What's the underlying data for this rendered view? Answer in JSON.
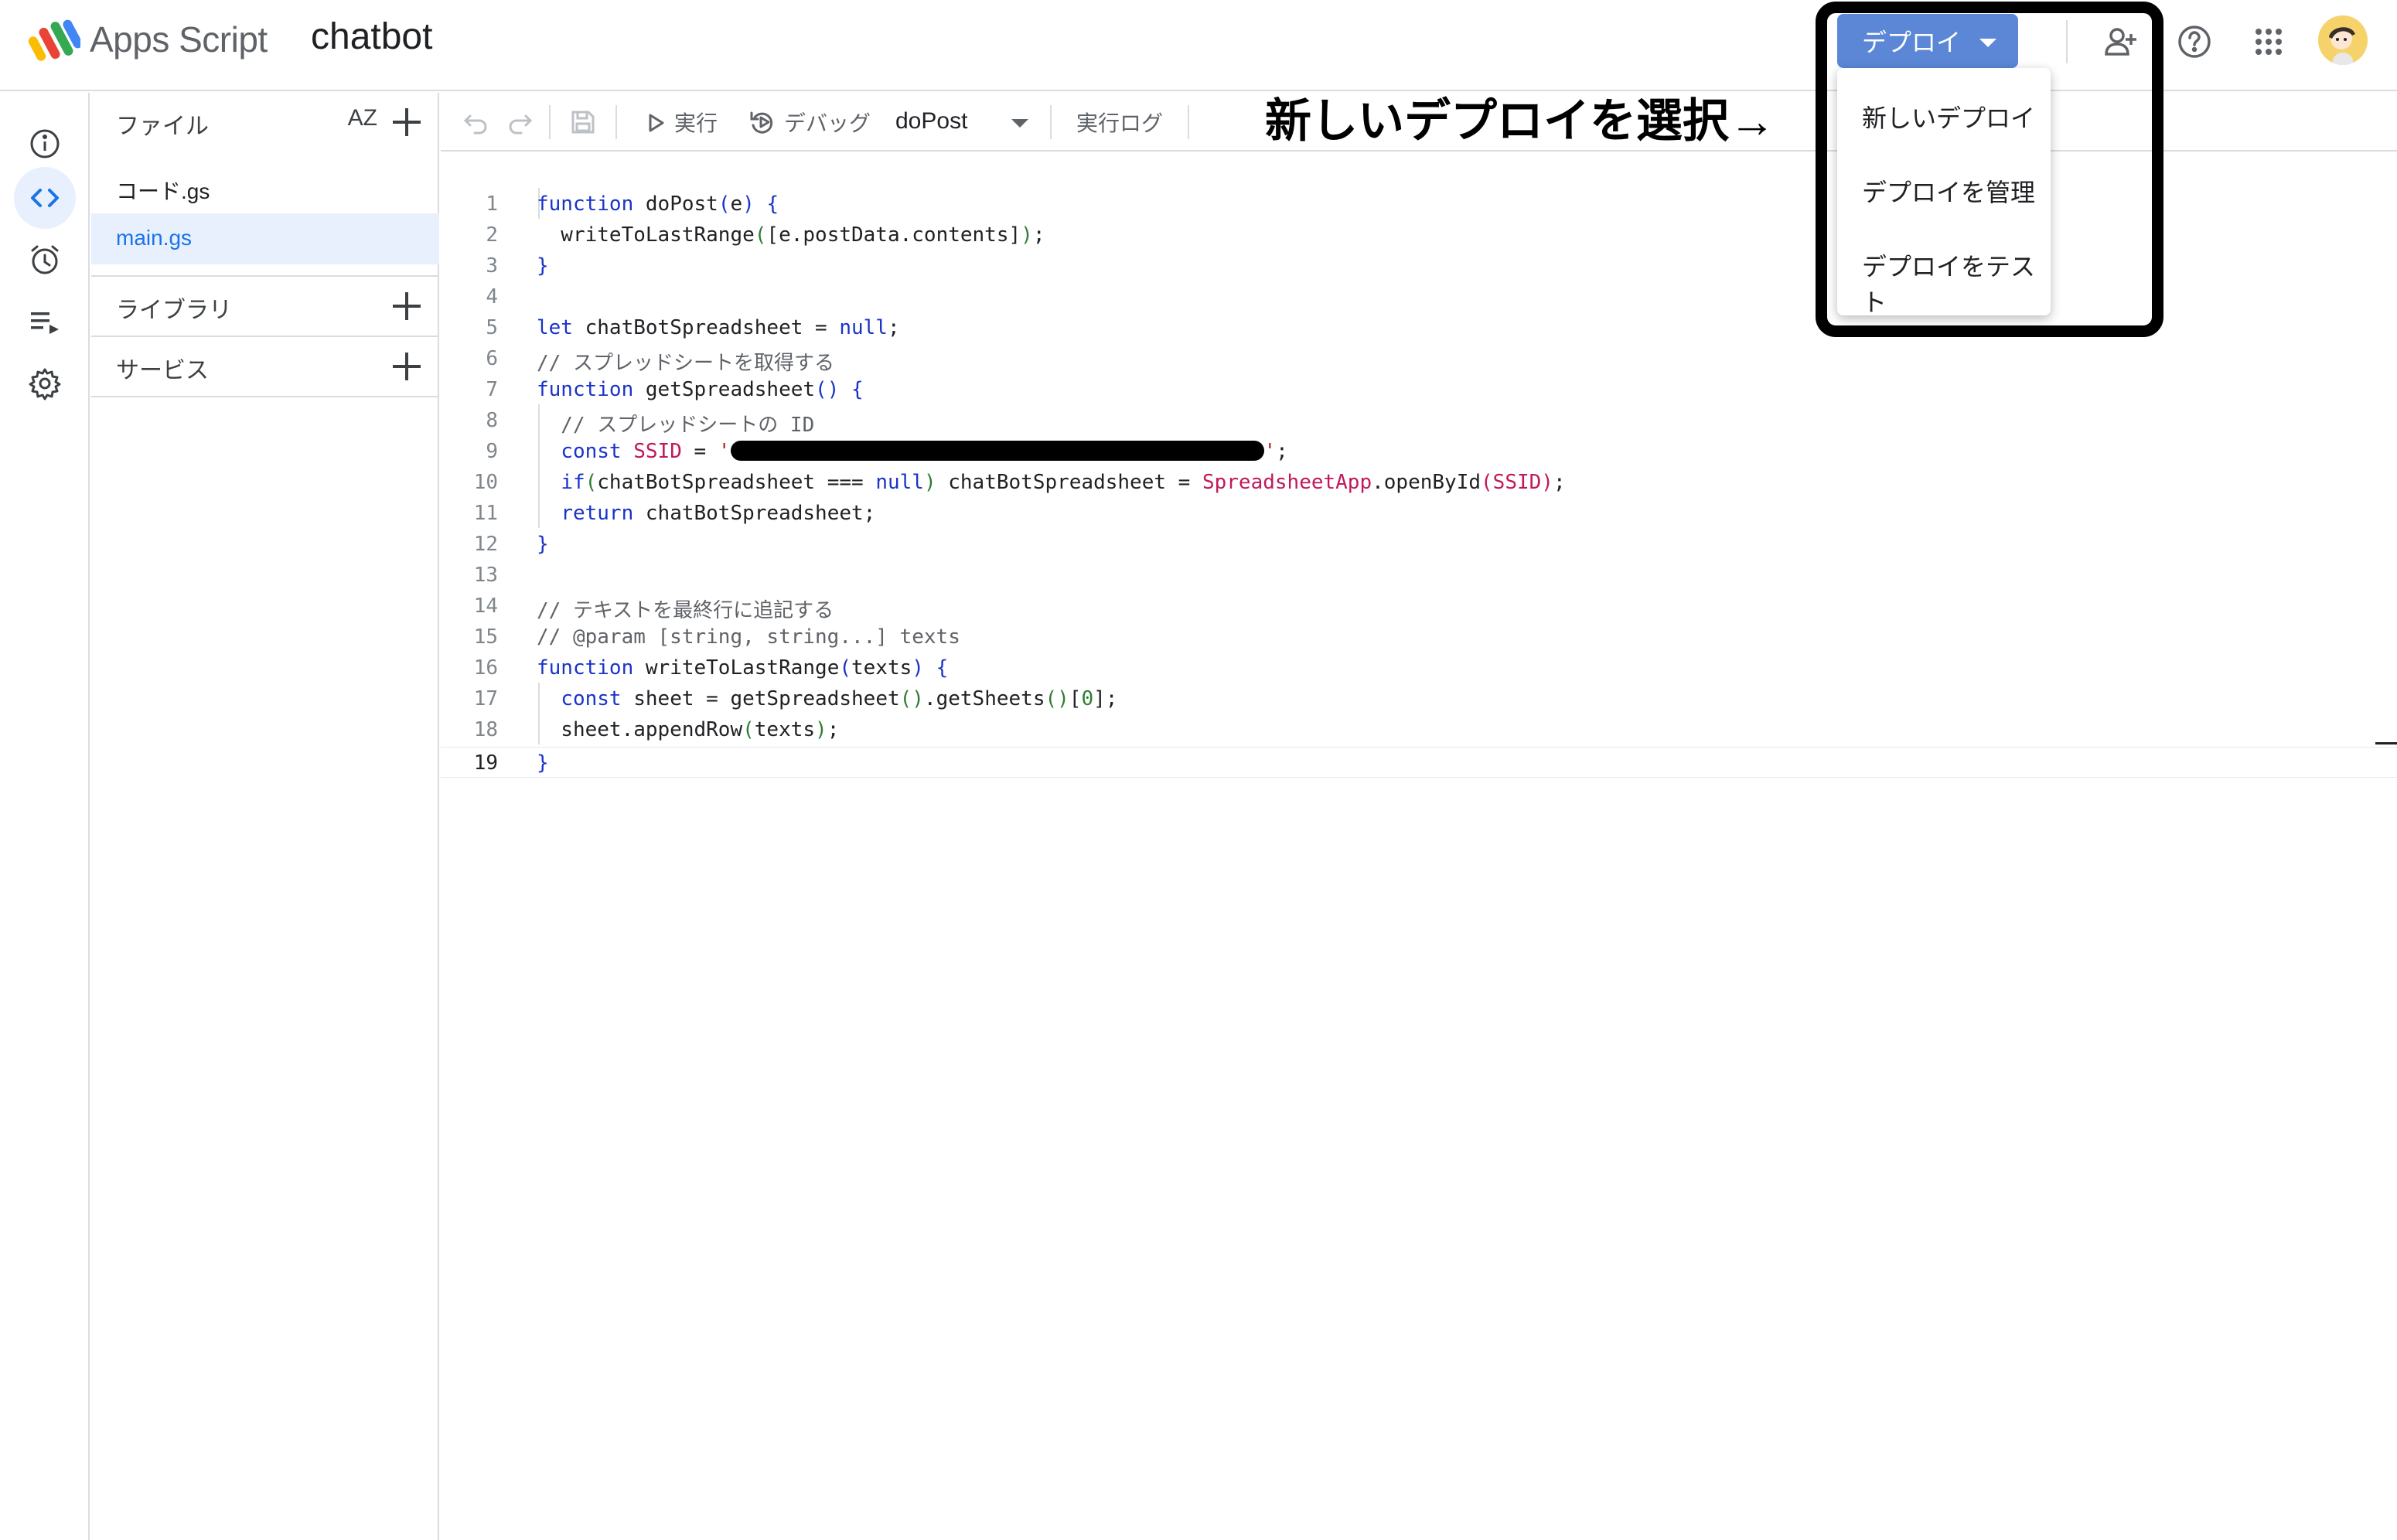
{
  "header": {
    "app_name": "Apps Script",
    "project_name": "chatbot",
    "deploy_label": "デプロイ"
  },
  "deploy_menu": {
    "items": [
      "新しいデプロイ",
      "デプロイを管理",
      "デプロイをテスト"
    ]
  },
  "annotation": "新しいデプロイを選択→",
  "files_panel": {
    "title": "ファイル",
    "sort_label": "AZ",
    "files": [
      "コード.gs",
      "main.gs"
    ],
    "selected_file": "main.gs",
    "libraries_label": "ライブラリ",
    "services_label": "サービス"
  },
  "toolbar": {
    "run_label": "実行",
    "debug_label": "デバッグ",
    "function_name": "doPost",
    "exec_log_label": "実行ログ"
  },
  "editor": {
    "current_line": 19,
    "line_numbers": [
      "1",
      "2",
      "3",
      "4",
      "5",
      "6",
      "7",
      "8",
      "9",
      "10",
      "11",
      "12",
      "13",
      "14",
      "15",
      "16",
      "17",
      "18",
      "19"
    ],
    "lines": [
      "function doPost(e) {",
      "  writeToLastRange([e.postData.contents]);",
      "}",
      "",
      "let chatBotSpreadsheet = null;",
      "// スプレッドシートを取得する",
      "function getSpreadsheet() {",
      "  // スプレッドシートの ID",
      "  const SSID = '[redacted]';",
      "  if(chatBotSpreadsheet === null) chatBotSpreadsheet = SpreadsheetApp.openById(SSID);",
      "  return chatBotSpreadsheet;",
      "}",
      "",
      "// テキストを最終行に追記する",
      "// @param [string, string...] texts",
      "function writeToLastRange(texts) {",
      "  const sheet = getSpreadsheet().getSheets()[0];",
      "  sheet.appendRow(texts);",
      "}"
    ]
  },
  "colors": {
    "deploy_button": "#5b87d6",
    "selected_file_bg": "#e8f0fe",
    "accent": "#1a73e8",
    "keyword": "#1a33c9",
    "string": "#b3261e",
    "class_name": "#c2185b"
  },
  "icons": {
    "rail": [
      "info-icon",
      "code-icon",
      "clock-icon",
      "executions-icon",
      "settings-icon"
    ],
    "header": [
      "add-person-icon",
      "help-icon",
      "apps-grid-icon"
    ]
  }
}
